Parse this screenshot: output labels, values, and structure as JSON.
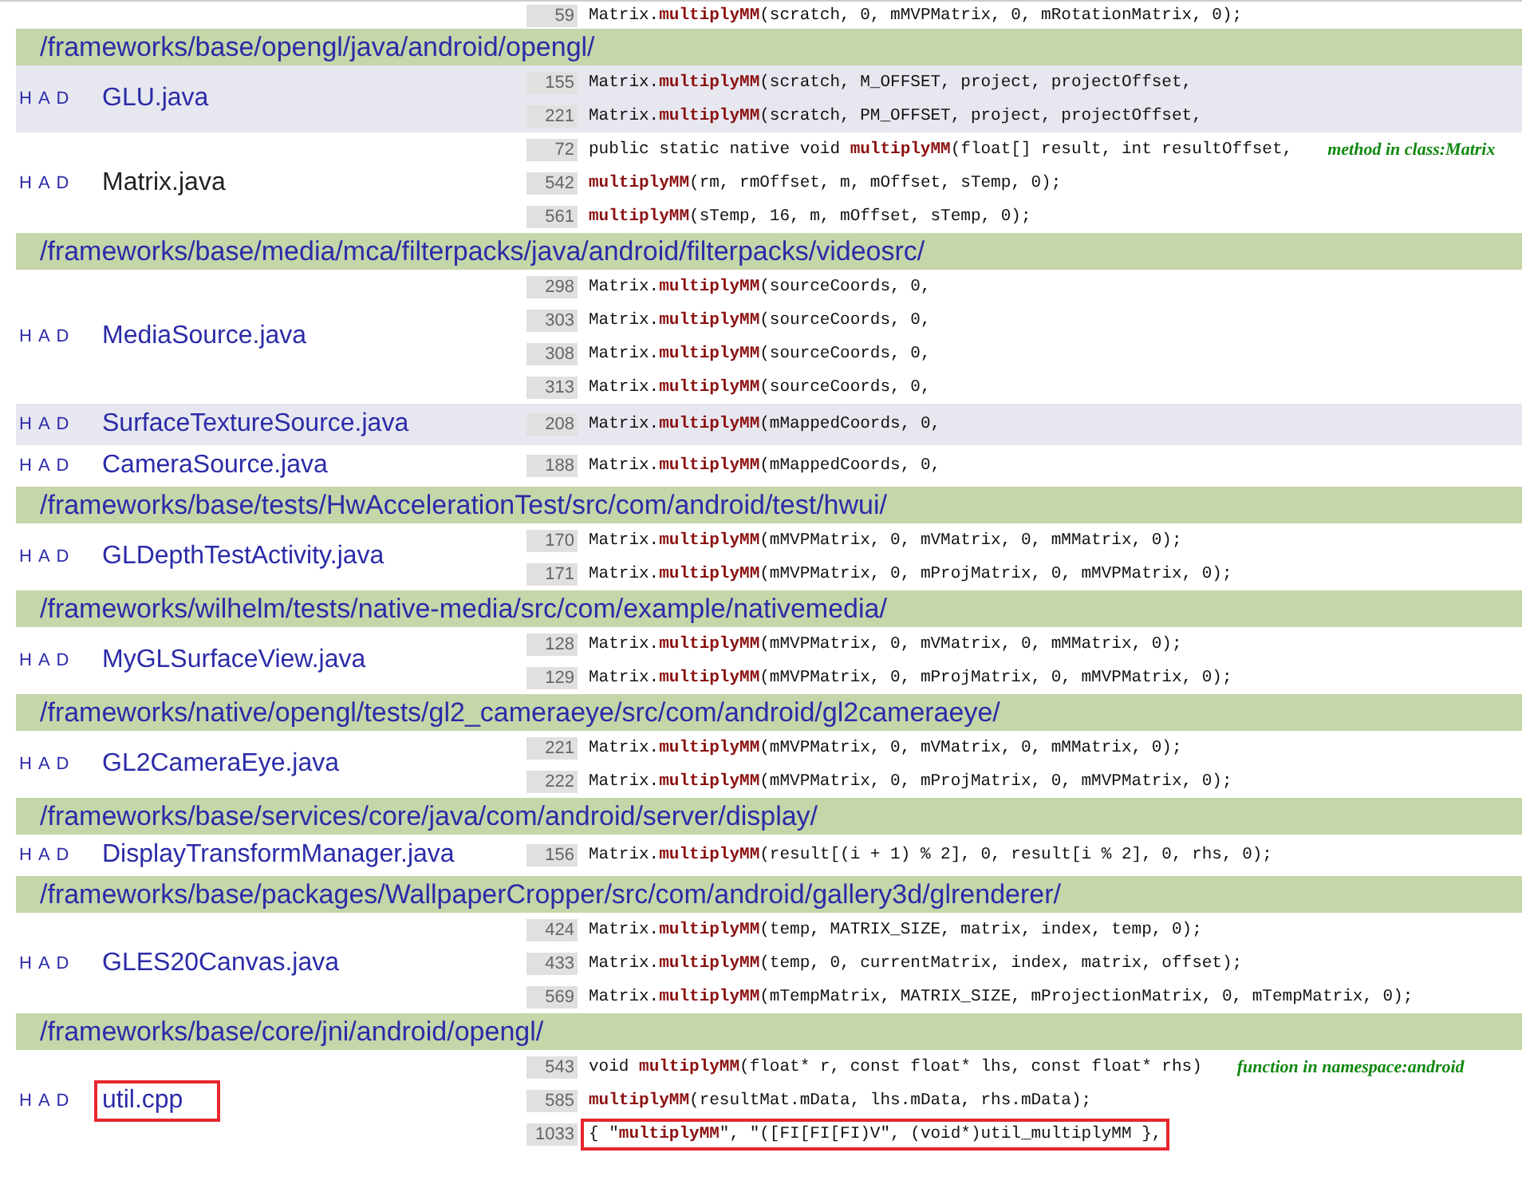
{
  "cut_off_line": {
    "number": "59",
    "code": "Matrix.**multiplyMM**(scratch, 0, mMVPMatrix, 0, mRotationMatrix, 0);"
  },
  "groups": [
    {
      "dir": "/frameworks/base/opengl/java/android/opengl/",
      "files": [
        {
          "links": [
            "H",
            "A",
            "D"
          ],
          "name": "GLU.java",
          "highlighted": true,
          "visited": false,
          "annotated": false,
          "lines": [
            {
              "number": "155",
              "code": "Matrix.**multiplyMM**(scratch, M_OFFSET, project, projectOffset,",
              "annotated": false
            },
            {
              "number": "221",
              "code": "Matrix.**multiplyMM**(scratch, PM_OFFSET, project, projectOffset,",
              "annotated": false
            }
          ]
        },
        {
          "links": [
            "H",
            "A",
            "D"
          ],
          "name": "Matrix.java",
          "highlighted": false,
          "visited": true,
          "annotated": false,
          "lines": [
            {
              "number": "72",
              "code": "public static native void **multiplyMM**(float[] result, int resultOffset,",
              "note": "method in class:Matrix",
              "annotated": false
            },
            {
              "number": "542",
              "code": "**multiplyMM**(rm, rmOffset, m, mOffset, sTemp, 0);",
              "annotated": false
            },
            {
              "number": "561",
              "code": "**multiplyMM**(sTemp, 16, m, mOffset, sTemp, 0);",
              "annotated": false
            }
          ]
        }
      ]
    },
    {
      "dir": "/frameworks/base/media/mca/filterpacks/java/android/filterpacks/videosrc/",
      "files": [
        {
          "links": [
            "H",
            "A",
            "D"
          ],
          "name": "MediaSource.java",
          "highlighted": false,
          "visited": false,
          "annotated": false,
          "lines": [
            {
              "number": "298",
              "code": "Matrix.**multiplyMM**(sourceCoords, 0,",
              "annotated": false
            },
            {
              "number": "303",
              "code": "Matrix.**multiplyMM**(sourceCoords, 0,",
              "annotated": false
            },
            {
              "number": "308",
              "code": "Matrix.**multiplyMM**(sourceCoords, 0,",
              "annotated": false
            },
            {
              "number": "313",
              "code": "Matrix.**multiplyMM**(sourceCoords, 0,",
              "annotated": false
            }
          ]
        },
        {
          "links": [
            "H",
            "A",
            "D"
          ],
          "name": "SurfaceTextureSource.java",
          "highlighted": true,
          "visited": false,
          "annotated": false,
          "lines": [
            {
              "number": "208",
              "code": "Matrix.**multiplyMM**(mMappedCoords, 0,",
              "annotated": false
            }
          ]
        },
        {
          "links": [
            "H",
            "A",
            "D"
          ],
          "name": "CameraSource.java",
          "highlighted": false,
          "visited": false,
          "annotated": false,
          "lines": [
            {
              "number": "188",
              "code": "Matrix.**multiplyMM**(mMappedCoords, 0,",
              "annotated": false
            }
          ]
        }
      ]
    },
    {
      "dir": "/frameworks/base/tests/HwAccelerationTest/src/com/android/test/hwui/",
      "files": [
        {
          "links": [
            "H",
            "A",
            "D"
          ],
          "name": "GLDepthTestActivity.java",
          "highlighted": false,
          "visited": false,
          "annotated": false,
          "lines": [
            {
              "number": "170",
              "code": "Matrix.**multiplyMM**(mMVPMatrix, 0, mVMatrix, 0, mMMatrix, 0);",
              "annotated": false
            },
            {
              "number": "171",
              "code": "Matrix.**multiplyMM**(mMVPMatrix, 0, mProjMatrix, 0, mMVPMatrix, 0);",
              "annotated": false
            }
          ]
        }
      ]
    },
    {
      "dir": "/frameworks/wilhelm/tests/native-media/src/com/example/nativemedia/",
      "files": [
        {
          "links": [
            "H",
            "A",
            "D"
          ],
          "name": "MyGLSurfaceView.java",
          "highlighted": false,
          "visited": false,
          "annotated": false,
          "lines": [
            {
              "number": "128",
              "code": "Matrix.**multiplyMM**(mMVPMatrix, 0, mVMatrix, 0, mMMatrix, 0);",
              "annotated": false
            },
            {
              "number": "129",
              "code": "Matrix.**multiplyMM**(mMVPMatrix, 0, mProjMatrix, 0, mMVPMatrix, 0);",
              "annotated": false
            }
          ]
        }
      ]
    },
    {
      "dir": "/frameworks/native/opengl/tests/gl2_cameraeye/src/com/android/gl2cameraeye/",
      "files": [
        {
          "links": [
            "H",
            "A",
            "D"
          ],
          "name": "GL2CameraEye.java",
          "highlighted": false,
          "visited": false,
          "annotated": false,
          "lines": [
            {
              "number": "221",
              "code": "Matrix.**multiplyMM**(mMVPMatrix, 0, mVMatrix, 0, mMMatrix, 0);",
              "annotated": false
            },
            {
              "number": "222",
              "code": "Matrix.**multiplyMM**(mMVPMatrix, 0, mProjMatrix, 0, mMVPMatrix, 0);",
              "annotated": false
            }
          ]
        }
      ]
    },
    {
      "dir": "/frameworks/base/services/core/java/com/android/server/display/",
      "files": [
        {
          "links": [
            "H",
            "A",
            "D"
          ],
          "name": "DisplayTransformManager.java",
          "highlighted": false,
          "visited": false,
          "annotated": false,
          "lines": [
            {
              "number": "156",
              "code": "Matrix.**multiplyMM**(result[(i + 1) % 2], 0, result[i % 2], 0, rhs, 0);",
              "annotated": false
            }
          ]
        }
      ]
    },
    {
      "dir": "/frameworks/base/packages/WallpaperCropper/src/com/android/gallery3d/glrenderer/",
      "files": [
        {
          "links": [
            "H",
            "A",
            "D"
          ],
          "name": "GLES20Canvas.java",
          "highlighted": false,
          "visited": false,
          "annotated": false,
          "lines": [
            {
              "number": "424",
              "code": "Matrix.**multiplyMM**(temp, MATRIX_SIZE, matrix, index, temp, 0);",
              "annotated": false
            },
            {
              "number": "433",
              "code": "Matrix.**multiplyMM**(temp, 0, currentMatrix, index, matrix, offset);",
              "annotated": false
            },
            {
              "number": "569",
              "code": "Matrix.**multiplyMM**(mTempMatrix, MATRIX_SIZE, mProjectionMatrix, 0, mTempMatrix, 0);",
              "annotated": false
            }
          ]
        }
      ]
    },
    {
      "dir": "/frameworks/base/core/jni/android/opengl/",
      "files": [
        {
          "links": [
            "H",
            "A",
            "D"
          ],
          "name": "util.cpp",
          "highlighted": false,
          "visited": false,
          "annotated": true,
          "lines": [
            {
              "number": "543",
              "code": "void **multiplyMM**(float* r, const float* lhs, const float* rhs)",
              "note": "function in namespace:android",
              "annotated": false
            },
            {
              "number": "585",
              "code": "**multiplyMM**(resultMat.mData, lhs.mData, rhs.mData);",
              "annotated": false
            },
            {
              "number": "1033",
              "code": "{ \"**multiplyMM**\", \"([FI[FI[FI)V\", (void*)util_multiplyMM },",
              "annotated": true
            }
          ]
        }
      ]
    }
  ]
}
